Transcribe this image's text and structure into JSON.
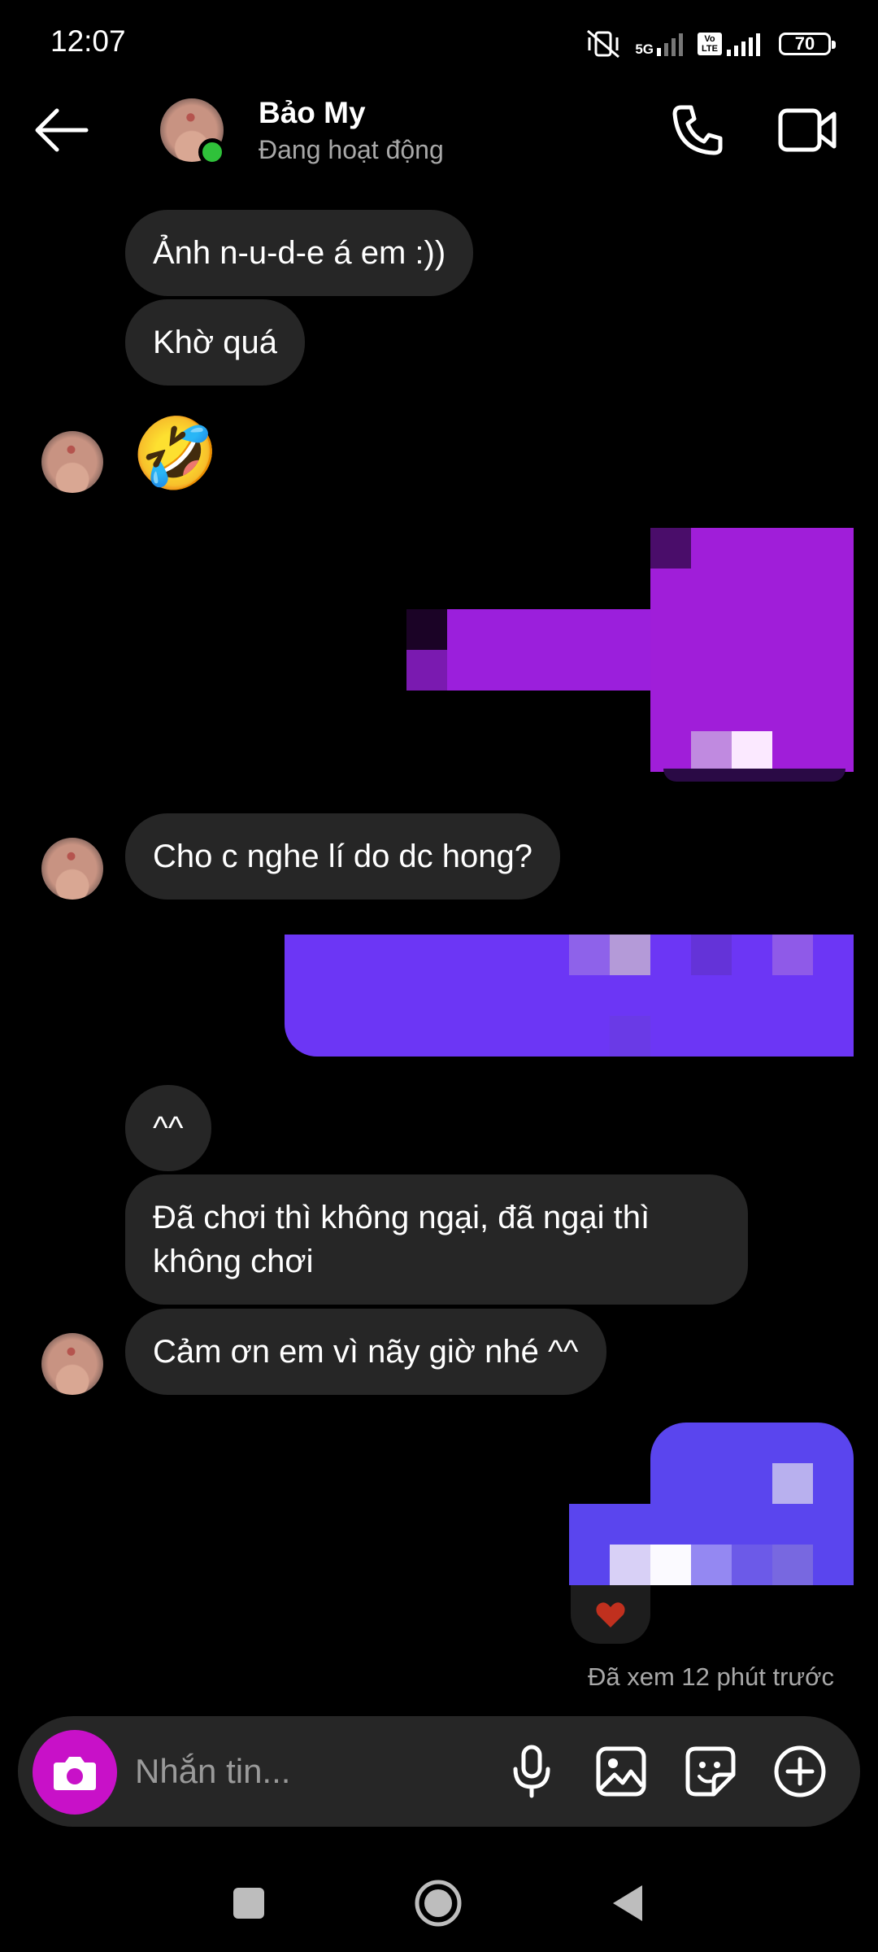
{
  "status_bar": {
    "time": "12:07",
    "network_label": "5G",
    "volte_label": "Vo LTE",
    "battery": "70"
  },
  "header": {
    "contact_name": "Bảo My",
    "contact_status": "Đang hoạt động"
  },
  "messages": [
    {
      "from": "contact",
      "text": "Ảnh n-u-d-e á em :))"
    },
    {
      "from": "contact",
      "text": "Khờ quá"
    },
    {
      "from": "contact",
      "text": "🤣"
    },
    {
      "from": "me",
      "text": "[censored]"
    },
    {
      "from": "contact",
      "text": "Cho c nghe lí do dc hong?"
    },
    {
      "from": "me",
      "text": "[censored]"
    },
    {
      "from": "contact",
      "text": "^^"
    },
    {
      "from": "contact",
      "text": "Đã chơi thì không ngại, đã ngại thì không chơi"
    },
    {
      "from": "contact",
      "text": "Cảm ơn em vì nãy giờ nhé ^^"
    },
    {
      "from": "me",
      "text": "[censored]"
    }
  ],
  "seen_receipt": "Đã xem 12 phút trước",
  "composer": {
    "placeholder": "Nhắn tin..."
  },
  "colors": {
    "background": "#000000",
    "bubble_incoming": "#262626",
    "camera_button": "#c811c8",
    "online_dot": "#2fc13a",
    "outgoing_censored": "#9b1fdc"
  }
}
